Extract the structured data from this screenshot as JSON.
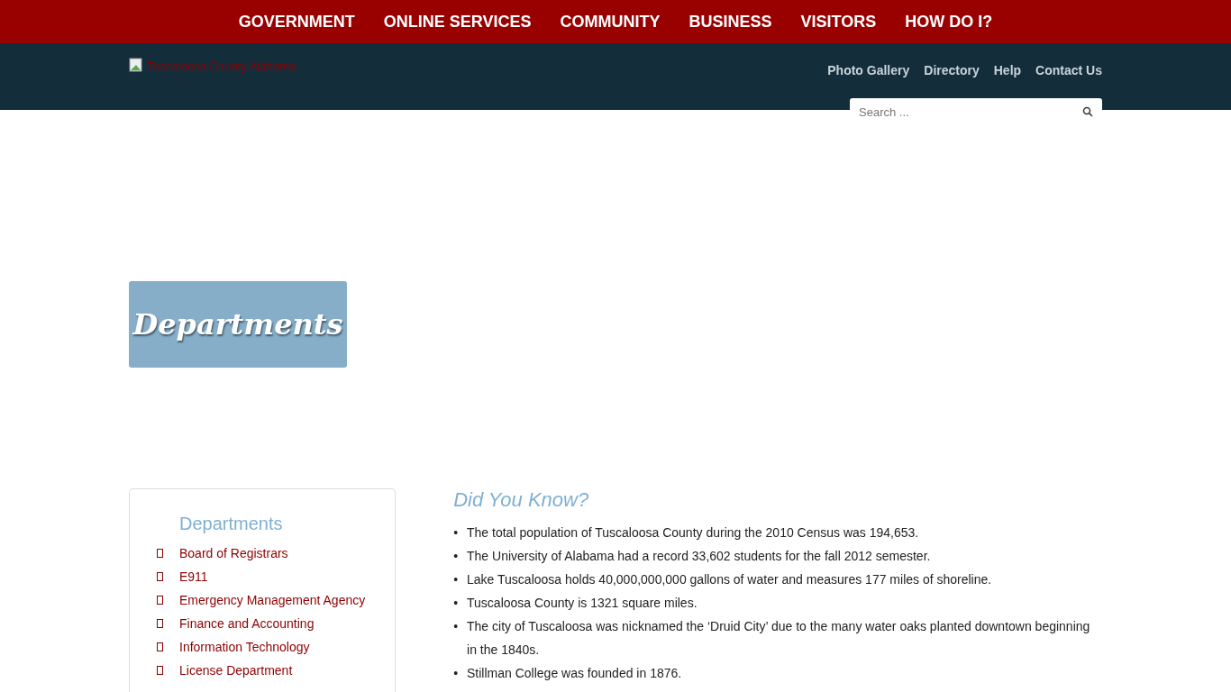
{
  "top_nav": [
    "GOVERNMENT",
    "ONLINE SERVICES",
    "COMMUNITY",
    "BUSINESS",
    "VISITORS",
    "HOW DO I?"
  ],
  "header": {
    "logo_alt": "Tuscaloosa County Alabama",
    "links": [
      "Photo Gallery",
      "Directory",
      "Help",
      "Contact Us"
    ],
    "search": {
      "placeholder": "Search ..."
    }
  },
  "banner": {
    "title": "Departments"
  },
  "sidebar": {
    "title": "Departments",
    "items": [
      "Board of Registrars",
      "E911",
      "Emergency Management Agency",
      "Finance and Accounting",
      "Information Technology",
      "License Department"
    ]
  },
  "did_you_know": {
    "title": "Did You Know?",
    "facts": [
      {
        "bullet": "•",
        "text": "The total population of Tuscaloosa County during the 2010 Census was 194,653."
      },
      {
        "bullet": "•",
        "text": "The University of Alabama had a record 33,602 students for the fall 2012 semester."
      },
      {
        "bullet": "•",
        "text": "Lake Tuscaloosa holds 40,000,000,000 gallons of water and measures 177 miles of shoreline."
      },
      {
        "bullet": "•",
        "text": "Tuscaloosa County is 1321 square miles."
      },
      {
        "bullet": "•",
        "text": "The city of Tuscaloosa was nicknamed the ‘Druid City’ due to the many water oaks planted downtown beginning in the 1840s."
      },
      {
        "bullet": "•",
        "text": "Stillman College was founded in 1876."
      }
    ]
  }
}
